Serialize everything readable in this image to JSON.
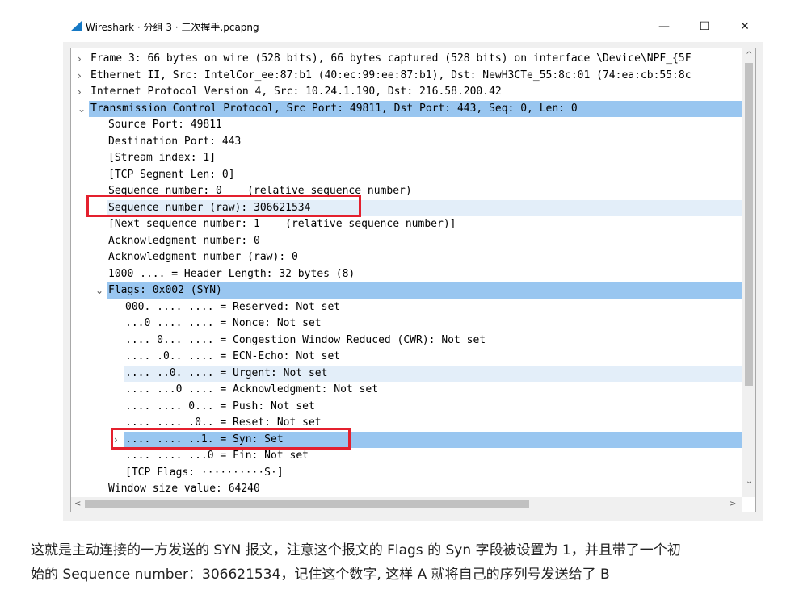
{
  "window": {
    "title": "Wireshark · 分组 3 · 三次握手.pcapng",
    "controls": {
      "minimize": "—",
      "maximize": "☐",
      "close": "✕"
    }
  },
  "tree_rows": [
    {
      "text": "Frame 3: 66 bytes on wire (528 bits), 66 bytes captured (528 bits) on interface \\Device\\NPF_{5F",
      "toggle": "›"
    },
    {
      "text": "Ethernet II, Src: IntelCor_ee:87:b1 (40:ec:99:ee:87:b1), Dst: NewH3CTe_55:8c:01 (74:ea:cb:55:8c",
      "toggle": "›"
    },
    {
      "text": "Internet Protocol Version 4, Src: 10.24.1.190, Dst: 216.58.200.42",
      "toggle": "›"
    },
    {
      "text": "Transmission Control Protocol, Src Port: 49811, Dst Port: 443, Seq: 0, Len: 0",
      "toggle": "⌄"
    },
    {
      "text": "Source Port: 49811"
    },
    {
      "text": "Destination Port: 443"
    },
    {
      "text": "[Stream index: 1]"
    },
    {
      "text": "[TCP Segment Len: 0]"
    },
    {
      "text": "Sequence number: 0    (relative sequence number)"
    },
    {
      "text": "Sequence number (raw): 306621534"
    },
    {
      "text": "[Next sequence number: 1    (relative sequence number)]"
    },
    {
      "text": "Acknowledgment number: 0"
    },
    {
      "text": "Acknowledgment number (raw): 0"
    },
    {
      "text": "1000 .... = Header Length: 32 bytes (8)"
    },
    {
      "text": "Flags: 0x002 (SYN)",
      "toggle": "⌄"
    },
    {
      "text": "000. .... .... = Reserved: Not set"
    },
    {
      "text": "...0 .... .... = Nonce: Not set"
    },
    {
      "text": ".... 0... .... = Congestion Window Reduced (CWR): Not set"
    },
    {
      "text": ".... .0.. .... = ECN-Echo: Not set"
    },
    {
      "text": ".... ..0. .... = Urgent: Not set"
    },
    {
      "text": ".... ...0 .... = Acknowledgment: Not set"
    },
    {
      "text": ".... .... 0... = Push: Not set"
    },
    {
      "text": ".... .... .0.. = Reset: Not set"
    },
    {
      "text": ".... .... ..1. = Syn: Set",
      "toggle": "›"
    },
    {
      "text": ".... .... ...0 = Fin: Not set"
    },
    {
      "text": "[TCP Flags: ··········S·]"
    },
    {
      "text": "Window size value: 64240"
    }
  ],
  "scroll_arrows": {
    "up": "^",
    "down": "⌄",
    "left": "<",
    "right": ">"
  },
  "highlight": "#e4202e",
  "description": {
    "line1": "这就是主动连接的一方发送的 SYN 报文，注意这个报文的 Flags 的 Syn 字段被设置为 1，并且带了一个初",
    "line2": "始的 Sequence number：306621534，记住这个数字, 这样 A 就将自己的序列号发送给了 B"
  }
}
